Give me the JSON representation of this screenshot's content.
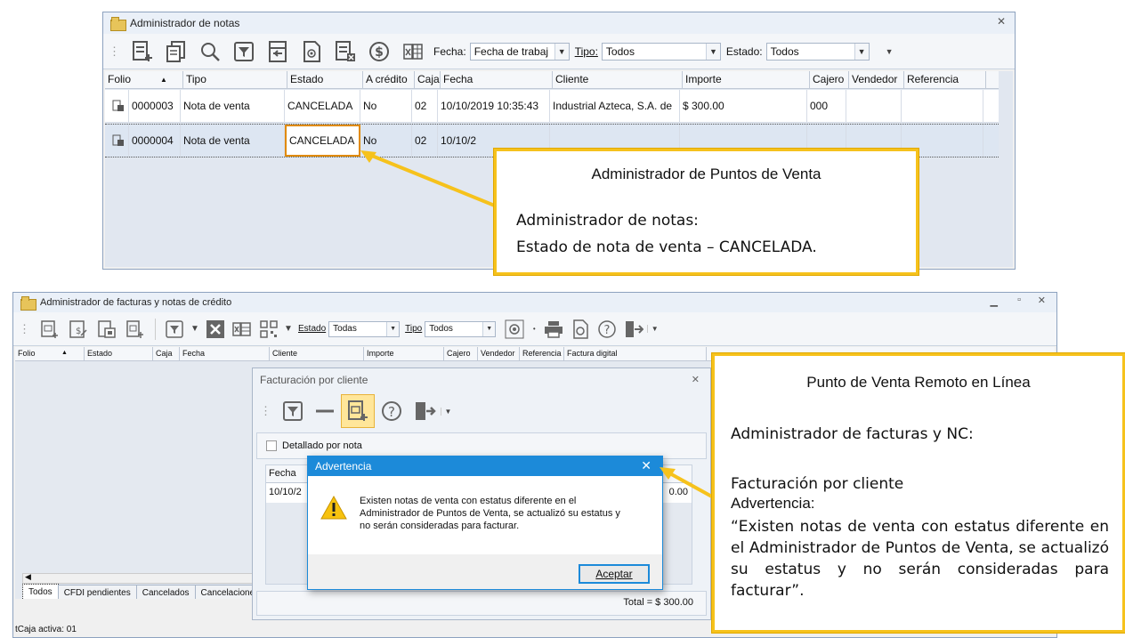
{
  "top_window": {
    "title": "Administrador de notas",
    "filters": {
      "fecha_label": "Fecha:",
      "fecha_value": "Fecha de trabaj",
      "tipo_label": "Tipo:",
      "tipo_value": "Todos",
      "estado_label": "Estado:",
      "estado_value": "Todos"
    },
    "columns": [
      "Folio",
      "Tipo",
      "Estado",
      "A crédito",
      "Caja",
      "Fecha",
      "Cliente",
      "Importe",
      "Cajero",
      "Vendedor",
      "Referencia"
    ],
    "rows": [
      {
        "folio": "0000003",
        "tipo": "Nota de venta",
        "estado": "CANCELADA",
        "credito": "No",
        "caja": "02",
        "fecha": "10/10/2019 10:35:43",
        "cliente": "Industrial Azteca, S.A. de",
        "importe": "$ 300.00",
        "cajero": "000",
        "vendedor": "",
        "referencia": ""
      },
      {
        "folio": "0000004",
        "tipo": "Nota de venta",
        "estado": "CANCELADA",
        "credito": "No",
        "caja": "02",
        "fecha": "10/10/2",
        "cliente": "",
        "importe": "",
        "cajero": "",
        "vendedor": "",
        "referencia": ""
      }
    ]
  },
  "callout_top": {
    "title": "Administrador de Puntos de Venta",
    "line1": "Administrador de notas:",
    "line2": "Estado de nota de venta – CANCELADA."
  },
  "bottom_window": {
    "title": "Administrador de facturas y notas de crédito",
    "filters": {
      "estado_label": "Estado",
      "estado_value": "Todas",
      "tipo_label": "Tipo",
      "tipo_value": "Todos"
    },
    "columns": [
      "Folio",
      "Estado",
      "Caja",
      "Fecha",
      "Cliente",
      "Importe",
      "Cajero",
      "Vendedor",
      "Referencia",
      "Factura digital"
    ],
    "tabs": [
      "Todos",
      "CFDI pendientes",
      "Cancelados",
      "Cancelacione"
    ],
    "status": "tCaja activa: 01"
  },
  "facturacion": {
    "title": "Facturación por cliente",
    "detallado_label": "Detallado por nota",
    "col_fecha": "Fecha",
    "row_fecha": "10/10/2",
    "row_importe": "0.00",
    "total": "Total = $ 300.00"
  },
  "warning_dialog": {
    "title": "Advertencia",
    "message": "Existen notas de venta con estatus diferente en el Administrador de Puntos de Venta, se actualizó su estatus y no serán consideradas para facturar.",
    "button": "Aceptar"
  },
  "callout_bottom": {
    "title": "Punto de Venta Remoto en Línea",
    "line1": "Administrador de facturas y NC:",
    "line2": "Facturación por cliente",
    "line3": "Advertencia:",
    "quote": "“Existen notas de venta con estatus diferente en el Administrador de Puntos de Venta, se actualizó su estatus y no serán consideradas para facturar”."
  },
  "colors": {
    "callout_border": "#f6c21c",
    "dialog_title": "#1c8ad9",
    "selection_border": "#e08a00"
  }
}
